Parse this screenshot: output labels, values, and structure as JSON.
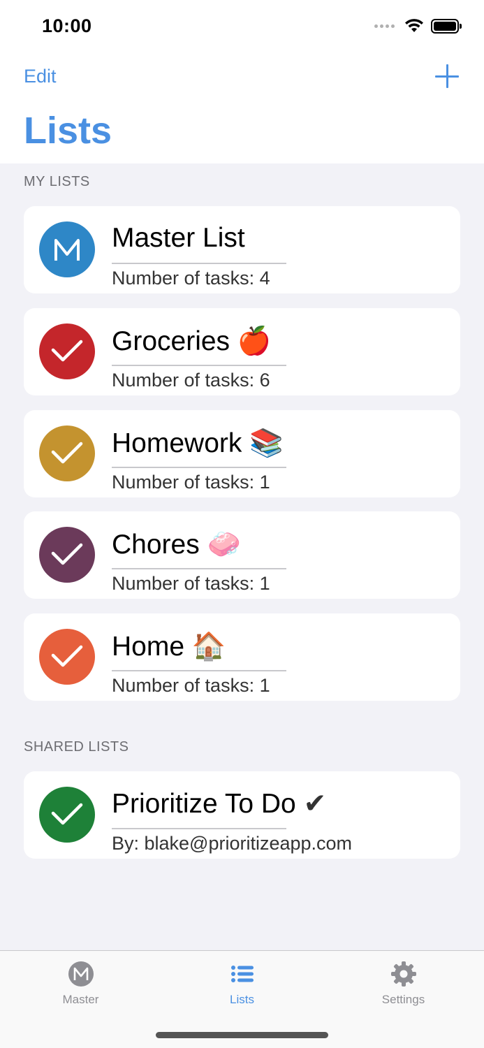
{
  "status_bar": {
    "time": "10:00"
  },
  "nav": {
    "edit_label": "Edit",
    "title": "Lists"
  },
  "sections": {
    "my_lists": "MY LISTS",
    "shared_lists": "SHARED LISTS"
  },
  "my_lists": [
    {
      "name": "Master List",
      "emoji": "",
      "subtitle": "Number of tasks: 4",
      "color": "#2e87c7",
      "icon": "m-logo-icon"
    },
    {
      "name": "Groceries",
      "emoji": "🍎",
      "subtitle": "Number of tasks: 6",
      "color": "#c4262b",
      "icon": "checkmark-icon"
    },
    {
      "name": "Homework",
      "emoji": "📚",
      "subtitle": "Number of tasks: 1",
      "color": "#c4932f",
      "icon": "checkmark-icon"
    },
    {
      "name": "Chores",
      "emoji": "🧼",
      "subtitle": "Number of tasks: 1",
      "color": "#6b3a5a",
      "icon": "checkmark-icon"
    },
    {
      "name": "Home",
      "emoji": "🏠",
      "subtitle": "Number of tasks: 1",
      "color": "#e65f3c",
      "icon": "checkmark-icon"
    }
  ],
  "shared_lists": [
    {
      "name": "Prioritize To Do",
      "emoji": "✔",
      "subtitle": "By: blake@prioritizeapp.com",
      "color": "#1e8138",
      "icon": "checkmark-icon"
    }
  ],
  "tabs": [
    {
      "label": "Master",
      "icon": "m-logo-icon",
      "active": false
    },
    {
      "label": "Lists",
      "icon": "list-icon",
      "active": true
    },
    {
      "label": "Settings",
      "icon": "gear-icon",
      "active": false
    }
  ],
  "colors": {
    "accent": "#4a90e2",
    "inactive_tab": "#8e8e93"
  }
}
